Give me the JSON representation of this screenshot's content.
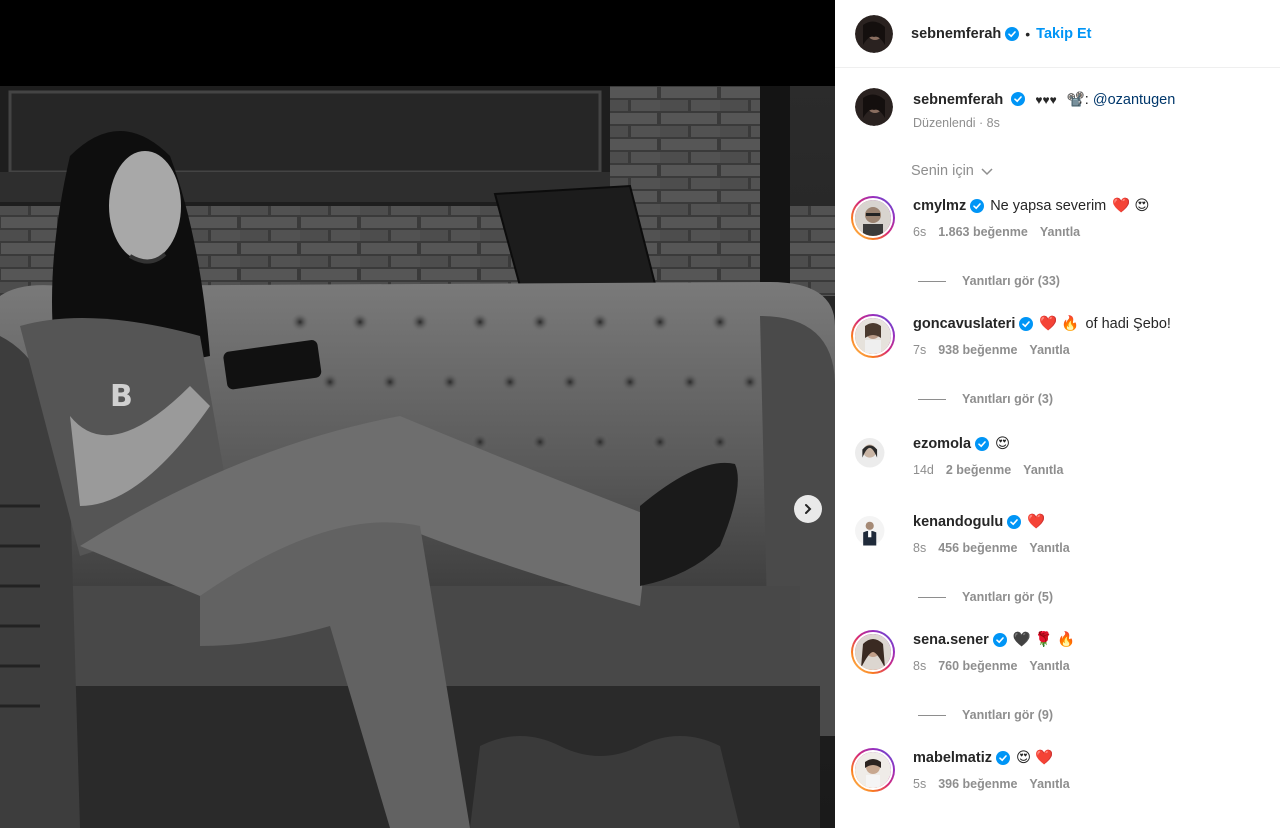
{
  "post": {
    "author": "sebnemferah",
    "follow_label": "Takip Et",
    "separator": "•"
  },
  "caption": {
    "author": "sebnemferah",
    "text_hearts": "♥♥♥",
    "text_camera": "📽️:",
    "mention": "@ozantugen",
    "edited": "Düzenlendi · 8s"
  },
  "sort_label": "Senin için",
  "comments": [
    {
      "user": "cmylmz",
      "text": "Ne yapsa severim",
      "emoji": "❤️ 😍",
      "time": "6s",
      "likes": "1.863 beğenme",
      "reply": "Yanıtla",
      "view_replies": "Yanıtları gör (33)"
    },
    {
      "user": "goncavuslateri",
      "text": "of hadi Şebo!",
      "emoji_before": "❤️ 🔥",
      "time": "7s",
      "likes": "938 beğenme",
      "reply": "Yanıtla",
      "view_replies": "Yanıtları gör (3)"
    },
    {
      "user": "ezomola",
      "emoji": "😍",
      "time": "14d",
      "likes": "2 beğenme",
      "reply": "Yanıtla"
    },
    {
      "user": "kenandogulu",
      "emoji": "❤️",
      "time": "8s",
      "likes": "456 beğenme",
      "reply": "Yanıtla",
      "view_replies": "Yanıtları gör (5)"
    },
    {
      "user": "sena.sener",
      "emoji": "🖤 🌹 🔥",
      "time": "8s",
      "likes": "760 beğenme",
      "reply": "Yanıtla",
      "view_replies": "Yanıtları gör (9)"
    },
    {
      "user": "mabelmatiz",
      "emoji": "😍 ❤️",
      "time": "5s",
      "likes": "396 beğenme",
      "reply": "Yanıtla"
    }
  ],
  "colors": {
    "accent": "#0095f6",
    "verified": "#0095f6",
    "muted": "#8e8e8e",
    "heart": "#ed4956"
  }
}
